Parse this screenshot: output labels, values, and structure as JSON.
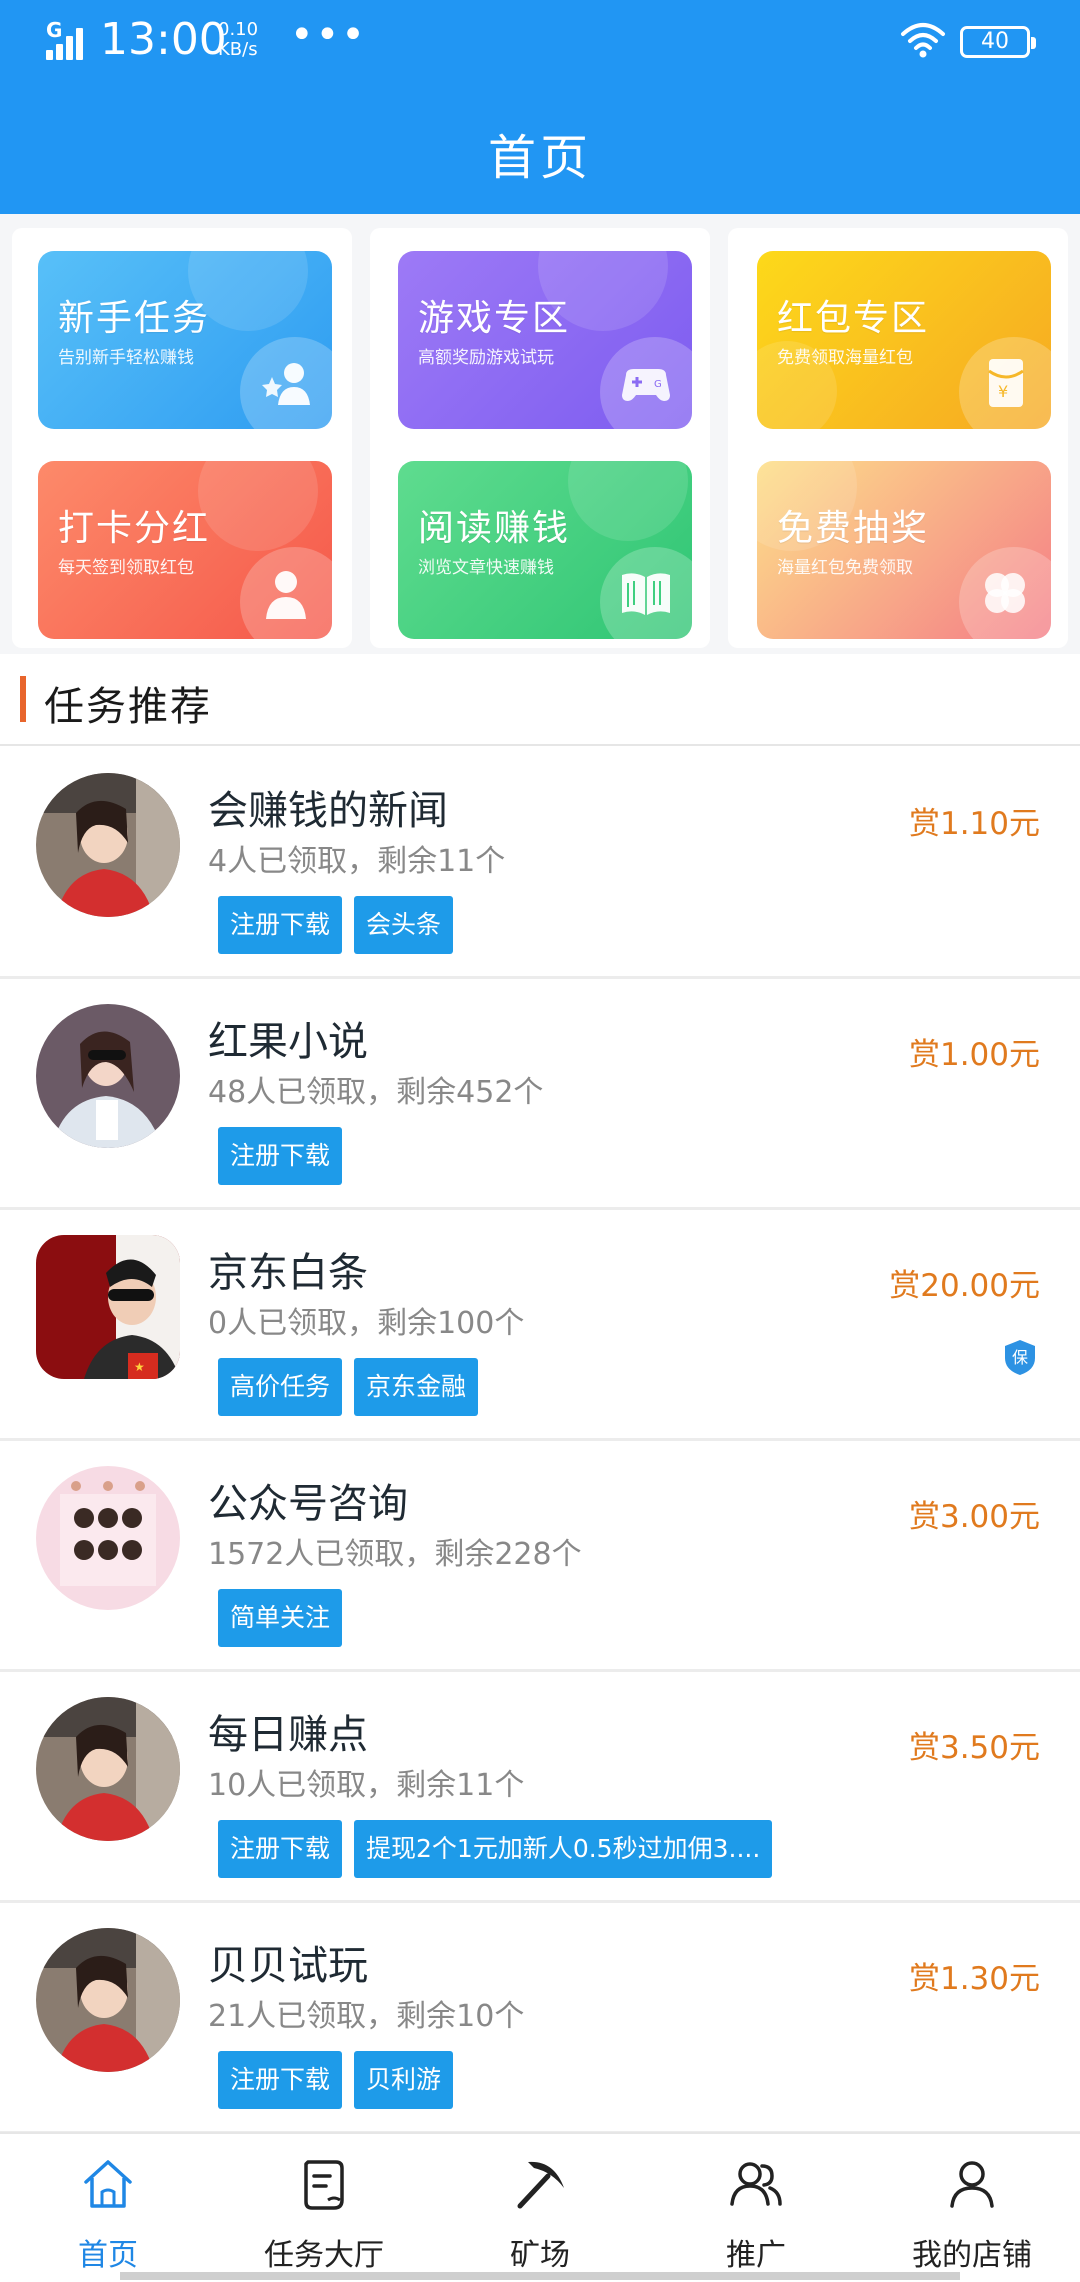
{
  "status_bar": {
    "network": "G",
    "time": "13:00",
    "speed_value": "0.10",
    "speed_unit": "KB/s",
    "more": "•••",
    "battery": "40"
  },
  "header": {
    "title": "首页"
  },
  "categories": [
    {
      "title": "新手任务",
      "subtitle": "告别新手轻松赚钱",
      "icon": "user-star-icon"
    },
    {
      "title": "游戏专区",
      "subtitle": "高额奖励游戏试玩",
      "icon": "gamepad-icon"
    },
    {
      "title": "红包专区",
      "subtitle": "免费领取海量红包",
      "icon": "red-envelope-icon"
    },
    {
      "title": "打卡分红",
      "subtitle": "每天签到领取红包",
      "icon": "user-icon"
    },
    {
      "title": "阅读赚钱",
      "subtitle": "浏览文章快速赚钱",
      "icon": "book-icon"
    },
    {
      "title": "免费抽奖",
      "subtitle": "海量红包免费领取",
      "icon": "clover-icon"
    }
  ],
  "section": {
    "title": "任务推荐"
  },
  "tasks": [
    {
      "title": "会赚钱的新闻",
      "count": "4人已领取，剩余11个",
      "reward": "赏1.10元",
      "tags": [
        "注册下载",
        "会头条"
      ],
      "avatar": "girl-red-hoodie"
    },
    {
      "title": "红果小说",
      "count": "48人已领取，剩余452个",
      "reward": "赏1.00元",
      "tags": [
        "注册下载"
      ],
      "avatar": "girl-sunglasses"
    },
    {
      "title": "京东白条",
      "count": "0人已领取，剩余100个",
      "reward": "赏20.00元",
      "tags": [
        "高价任务",
        "京东金融"
      ],
      "avatar": "man-sunglasses",
      "badge": "保"
    },
    {
      "title": "公众号咨询",
      "count": "1572人已领取，剩余228个",
      "reward": "赏3.00元",
      "tags": [
        "简单关注"
      ],
      "avatar": "pink-collage"
    },
    {
      "title": "每日赚点",
      "count": "10人已领取，剩余11个",
      "reward": "赏3.50元",
      "tags": [
        "注册下载",
        "提现2个1元加新人0.5秒过加佣3...."
      ],
      "avatar": "girl-red-hoodie"
    },
    {
      "title": "贝贝试玩",
      "count": "21人已领取，剩余10个",
      "reward": "赏1.30元",
      "tags": [
        "注册下载",
        "贝利游"
      ],
      "avatar": "girl-red-hoodie"
    }
  ],
  "bottom_nav": [
    {
      "label": "首页",
      "icon": "home-icon",
      "active": true
    },
    {
      "label": "任务大厅",
      "icon": "document-icon",
      "active": false
    },
    {
      "label": "矿场",
      "icon": "pickaxe-icon",
      "active": false
    },
    {
      "label": "推广",
      "icon": "users-icon",
      "active": false
    },
    {
      "label": "我的店铺",
      "icon": "person-icon",
      "active": false
    }
  ],
  "colors": {
    "primary": "#2196f3",
    "tag": "#1e9be9",
    "reward": "#e07a1e",
    "accent": "#e8652c",
    "nav_active": "#1f87e5"
  }
}
